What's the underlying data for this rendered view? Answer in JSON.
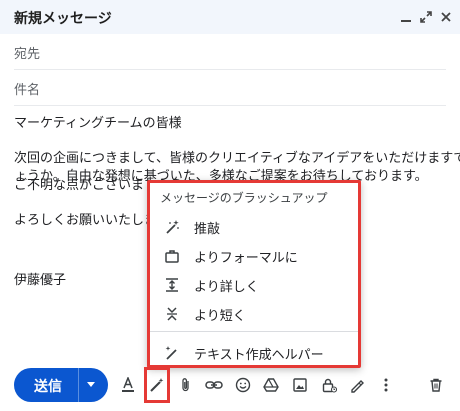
{
  "window": {
    "title": "新規メッセージ"
  },
  "fields": {
    "to_label": "宛先",
    "subject_label": "件名"
  },
  "body": {
    "greeting": "マーケティングチームの皆様",
    "para1_line1": "次回の企画につきまして、皆様のクリエイティブなアイデアをいただけますでし",
    "para1_line2": "ょうか。自由な発想に基づいた、多様なご提案をお待ちしております。",
    "para2": "ご不明な点がございましたら",
    "para3": "よろしくお願いいたします",
    "signature": "伊藤優子"
  },
  "popup": {
    "title": "メッセージのブラッシュアップ",
    "items": [
      {
        "label": "推敲",
        "icon": "sparkle-pen-icon"
      },
      {
        "label": "よりフォーマルに",
        "icon": "briefcase-icon"
      },
      {
        "label": "より詳しく",
        "icon": "expand-vertical-icon"
      },
      {
        "label": "より短く",
        "icon": "collapse-vertical-icon"
      }
    ],
    "footer_item": {
      "label": "テキスト作成ヘルパー",
      "icon": "pen-sparkle-icon"
    }
  },
  "toolbar": {
    "send_label": "送信",
    "icons": [
      "format-text-icon",
      "help-me-write-icon",
      "attach-icon",
      "link-icon",
      "emoji-icon",
      "drive-icon",
      "photo-icon",
      "confidential-lock-icon",
      "signature-pen-icon",
      "more-options-icon",
      "delete-icon"
    ]
  },
  "colors": {
    "accent": "#0b57d0",
    "highlight": "#e53935",
    "header_bg": "#f2f6fc"
  }
}
